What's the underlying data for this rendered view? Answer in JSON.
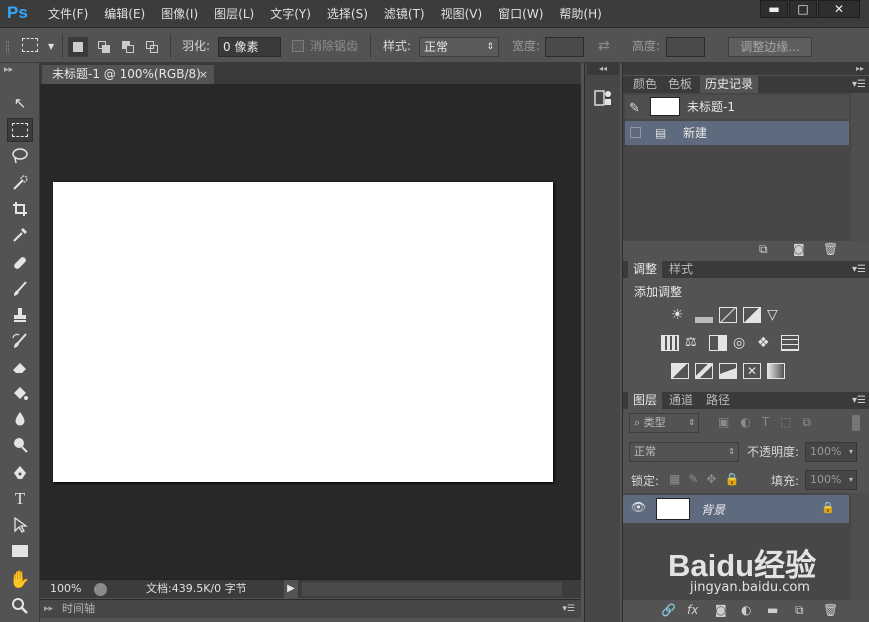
{
  "app": {
    "logo": "Ps"
  },
  "menu": [
    "文件(F)",
    "编辑(E)",
    "图像(I)",
    "图层(L)",
    "文字(Y)",
    "选择(S)",
    "滤镜(T)",
    "视图(V)",
    "窗口(W)",
    "帮助(H)"
  ],
  "window_controls": {
    "minimize": "▬",
    "restore": "□",
    "close": "✕"
  },
  "options": {
    "feather_label": "羽化:",
    "feather_value": "0 像素",
    "antialias_label": "消除锯齿",
    "style_label": "样式:",
    "style_value": "正常",
    "width_label": "宽度:",
    "height_label": "高度:",
    "refine_edge_button": "调整边缘..."
  },
  "document": {
    "tab_title": "未标题-1 @ 100%(RGB/8)",
    "tab_close": "×",
    "zoom": "100%",
    "doc_info": "文档:439.5K/0 字节",
    "timeline_label": "时间轴"
  },
  "panels": {
    "history_tabs": [
      "颜色",
      "色板",
      "历史记录"
    ],
    "history_snapshot": "未标题-1",
    "history_items": [
      "新建"
    ],
    "adjust_tabs": [
      "调整",
      "样式"
    ],
    "adjust_title": "添加调整",
    "layers_tabs": [
      "图层",
      "通道",
      "路径"
    ],
    "filter_kind": "类型",
    "blend_mode": "正常",
    "opacity_label": "不透明度:",
    "opacity_value": "100%",
    "lock_label": "锁定:",
    "fill_label": "填充:",
    "fill_value": "100%",
    "layers": [
      {
        "name": "背景"
      }
    ]
  },
  "watermark": {
    "brand": "Baidu经验",
    "url": "jingyan.baidu.com"
  }
}
